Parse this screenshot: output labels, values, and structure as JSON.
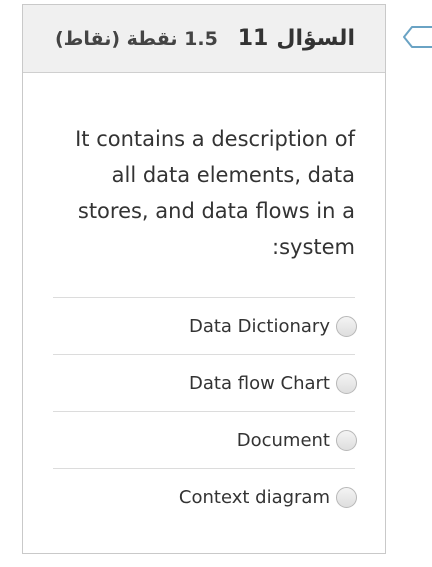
{
  "question": {
    "title_word": "السؤال",
    "number": "11",
    "points": "1.5 نقطة (نقاط)",
    "text": "It contains a description of all data elements, data stores, and data flows in a :system"
  },
  "options": [
    {
      "label": "Data Dictionary"
    },
    {
      "label": "Data flow Chart"
    },
    {
      "label": "Document"
    },
    {
      "label": "Context diagram"
    }
  ],
  "colors": {
    "header_bg": "#f0f0f0",
    "flag_outline": "#6aa3c4"
  },
  "icons": {
    "flag": "flag-outline-icon",
    "radio": "radio-unselected-icon"
  }
}
